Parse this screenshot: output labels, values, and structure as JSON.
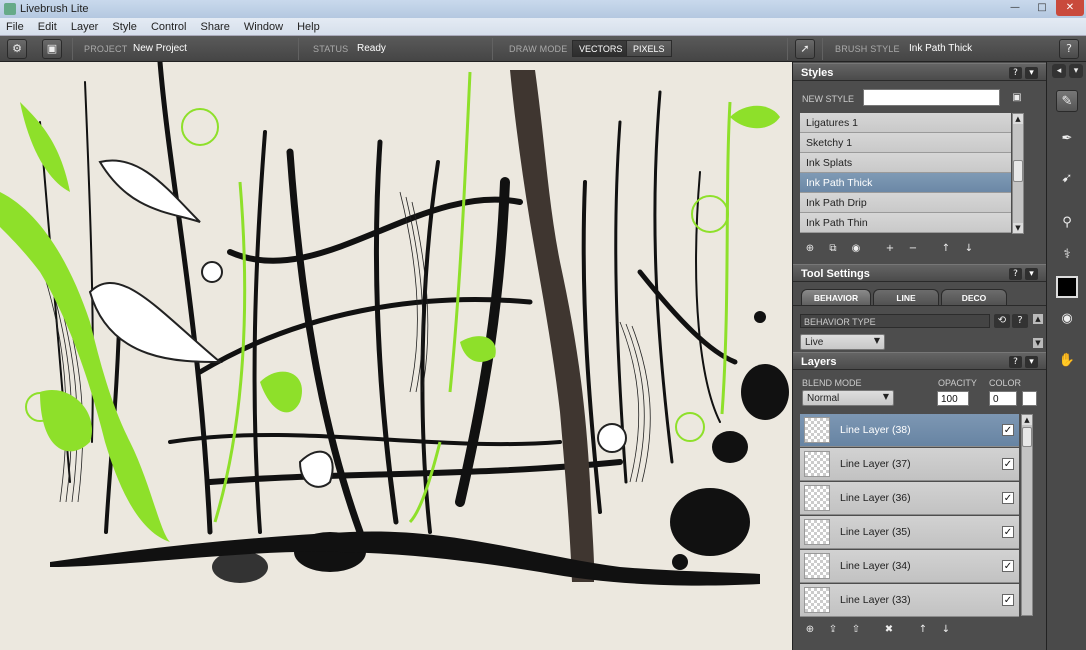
{
  "window": {
    "title": "Livebrush Lite"
  },
  "menu": [
    "File",
    "Edit",
    "Layer",
    "Style",
    "Control",
    "Share",
    "Window",
    "Help"
  ],
  "toolbar": {
    "project_label": "PROJECT",
    "project_value": "New Project",
    "status_label": "STATUS",
    "status_value": "Ready",
    "draw_mode_label": "DRAW MODE",
    "vectors_label": "VECTORS",
    "pixels_label": "PIXELS",
    "brush_style_label": "BRUSH STYLE",
    "brush_style_value": "Ink Path Thick",
    "active_draw_mode": "VECTORS"
  },
  "styles_panel": {
    "title": "Styles",
    "new_style_label": "NEW STYLE",
    "new_style_value": "",
    "items": [
      "Ligatures 1",
      "Sketchy 1",
      "Ink Splats",
      "Ink Path Thick",
      "Ink Path Drip",
      "Ink Path Thin"
    ],
    "selected": "Ink Path Thick"
  },
  "tool_settings": {
    "title": "Tool Settings",
    "tabs": [
      "BEHAVIOR",
      "LINE",
      "DECO"
    ],
    "active_tab": "BEHAVIOR",
    "behavior_type_label": "BEHAVIOR TYPE",
    "behavior_type_value": "Live"
  },
  "layers_panel": {
    "title": "Layers",
    "blend_mode_label": "BLEND MODE",
    "blend_mode_value": "Normal",
    "opacity_label": "OPACITY",
    "opacity_value": "100",
    "color_label": "COLOR",
    "color_value": "0",
    "layers": [
      {
        "name": "Line Layer (38)",
        "visible": true
      },
      {
        "name": "Line Layer (37)",
        "visible": true
      },
      {
        "name": "Line Layer (36)",
        "visible": true
      },
      {
        "name": "Line Layer (35)",
        "visible": true
      },
      {
        "name": "Line Layer (34)",
        "visible": true
      },
      {
        "name": "Line Layer (33)",
        "visible": true
      }
    ],
    "selected": "Line Layer (38)"
  },
  "colors": {
    "accent_green": "#8ee02a",
    "canvas_bg": "#ece8df",
    "selection": "#6e89a7",
    "brown_stroke": "#3f3630"
  },
  "icons": [
    "gear-icon",
    "save-icon",
    "pointer-icon",
    "help-icon",
    "collapse-icon",
    "layer-add-icon",
    "eye-icon",
    "plus-icon",
    "minus-icon",
    "arrow-up-icon",
    "arrow-down-icon",
    "delete-icon",
    "brush-icon",
    "pen-icon",
    "transform-icon",
    "eyedropper-icon",
    "stamp-icon",
    "hand-icon",
    "check-icon"
  ]
}
